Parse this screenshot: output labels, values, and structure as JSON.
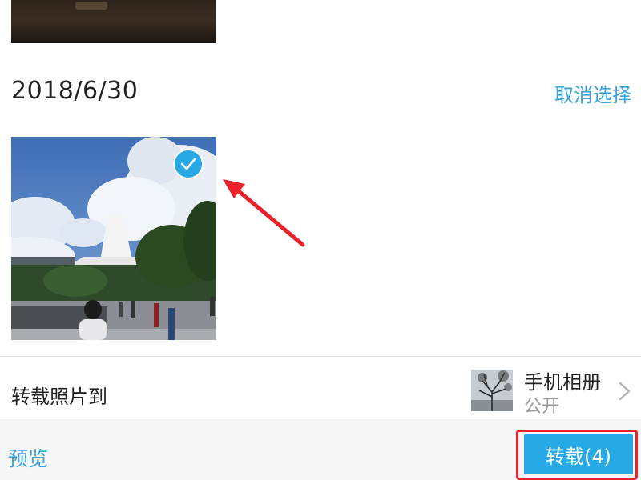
{
  "section": {
    "date": "2018/6/30",
    "cancel_selection": "取消选择"
  },
  "photo": {
    "selected": true
  },
  "destination": {
    "label": "转载照片到",
    "album_name": "手机相册",
    "album_privacy": "公开"
  },
  "bottom_bar": {
    "preview_label": "预览",
    "repost_label": "转载(4)"
  },
  "icons": {
    "check": "checkmark-icon",
    "chevron": "chevron-right-icon",
    "arrow": "arrow-annotation-icon"
  },
  "colors": {
    "accent": "#27a9e6",
    "link": "#3aa3dd",
    "annotation": "#e8212a"
  }
}
